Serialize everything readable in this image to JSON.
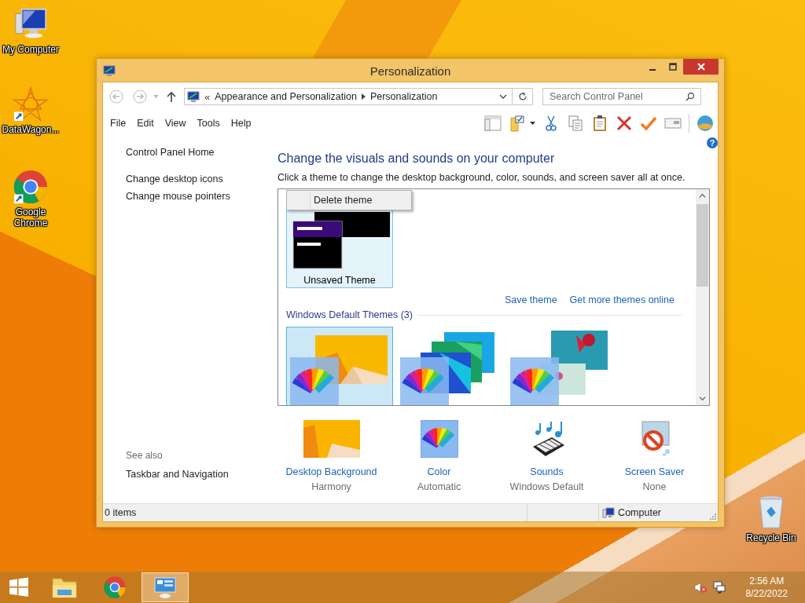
{
  "desktop_icons": [
    {
      "kind": "computer",
      "label": "My Computer"
    },
    {
      "kind": "datawagon",
      "label": "DataWagon..."
    },
    {
      "kind": "chrome",
      "label": "Google Chrome"
    },
    {
      "kind": "recycle",
      "label": "Recycle Bin"
    }
  ],
  "window": {
    "title": "Personalization",
    "address_prefix": "«",
    "crumbs": [
      "Appearance and Personalization",
      "Personalization"
    ],
    "search": {
      "placeholder": "Search Control Panel"
    },
    "menu": [
      "File",
      "Edit",
      "View",
      "Tools",
      "Help"
    ],
    "help": "?",
    "sidebar": {
      "links": [
        "Control Panel Home",
        "Change desktop icons",
        "Change mouse pointers"
      ],
      "see_also_title": "See also",
      "see_also_links": [
        "Taskbar and Navigation"
      ]
    },
    "heading": "Change the visuals and sounds on your computer",
    "description": "Click a theme to change the desktop background, color, sounds, and screen saver all at once.",
    "context_menu": [
      "Delete theme"
    ],
    "my_themes": [
      {
        "kind": "unsaved",
        "label": "Unsaved Theme",
        "selected": true
      }
    ],
    "theme_actions": [
      "Save theme",
      "Get more themes online"
    ],
    "default_section": "Windows Default Themes (3)",
    "default_themes": [
      {
        "kind": "harmony",
        "selected": true
      },
      {
        "kind": "lines",
        "selected": false
      },
      {
        "kind": "flowers",
        "selected": false
      }
    ],
    "settings": [
      {
        "kind": "background",
        "label": "Desktop Background",
        "value": "Harmony"
      },
      {
        "kind": "color",
        "label": "Color",
        "value": "Automatic"
      },
      {
        "kind": "sounds",
        "label": "Sounds",
        "value": "Windows Default"
      },
      {
        "kind": "screensaver",
        "label": "Screen Saver",
        "value": "None"
      }
    ],
    "status_bar": {
      "items": "0 items",
      "location": "Computer"
    }
  },
  "taskbar": {
    "apps": [
      {
        "kind": "explorer",
        "selected": false
      },
      {
        "kind": "chrome",
        "selected": false
      },
      {
        "kind": "control-panel",
        "selected": true
      }
    ],
    "time": "2:56 AM",
    "date": "8/22/2022"
  }
}
